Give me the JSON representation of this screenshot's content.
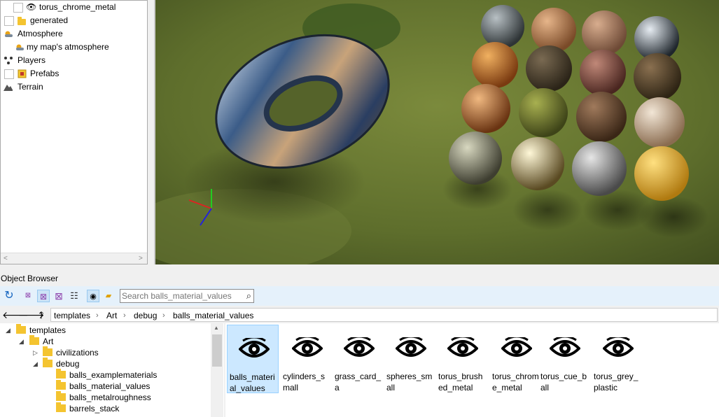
{
  "scene_tree": {
    "items": [
      {
        "label": "torus_chrome_metal",
        "icon": "eye-icon"
      },
      {
        "label": "generated",
        "icon": "folder-icon"
      },
      {
        "label": "Atmosphere",
        "icon": "atmosphere-icon"
      },
      {
        "label": "my map's atmosphere",
        "icon": "atmosphere-icon"
      },
      {
        "label": "Players",
        "icon": "players-icon"
      },
      {
        "label": "Prefabs",
        "icon": "prefab-icon"
      },
      {
        "label": "Terrain",
        "icon": "terrain-icon"
      }
    ],
    "scroll_left_glyph": "<",
    "scroll_right_glyph": ">"
  },
  "object_browser": {
    "title": "Object Browser",
    "search": {
      "placeholder": "Search balls_material_values",
      "value": ""
    },
    "nav": {
      "back": "🡐",
      "forward": "🡒",
      "up": "🡑"
    },
    "breadcrumb": [
      "templates",
      "Art",
      "debug",
      "balls_material_values"
    ],
    "breadcrumb_sep": "›",
    "folder_tree": [
      {
        "label": "templates",
        "expander": "◢"
      },
      {
        "label": "Art",
        "expander": "◢"
      },
      {
        "label": "civilizations",
        "expander": "▷"
      },
      {
        "label": "debug",
        "expander": "◢"
      },
      {
        "label": "balls_examplematerials",
        "expander": ""
      },
      {
        "label": "balls_material_values",
        "expander": ""
      },
      {
        "label": "balls_metalroughness",
        "expander": ""
      },
      {
        "label": "barrels_stack",
        "expander": ""
      }
    ],
    "files": [
      {
        "label": "balls_material_values",
        "selected": true
      },
      {
        "label": "cylinders_small",
        "selected": false
      },
      {
        "label": "grass_card_a",
        "selected": false
      },
      {
        "label": "spheres_small",
        "selected": false
      },
      {
        "label": "torus_brushed_metal",
        "selected": false
      },
      {
        "label": "torus_chrome_metal",
        "selected": false
      },
      {
        "label": "torus_cue_ball",
        "selected": false
      },
      {
        "label": "torus_grey_plastic",
        "selected": false
      }
    ]
  },
  "colors": {
    "accent": "#cce8ff",
    "toolbar": "#e5f1fb",
    "folder": "#f4c430"
  }
}
